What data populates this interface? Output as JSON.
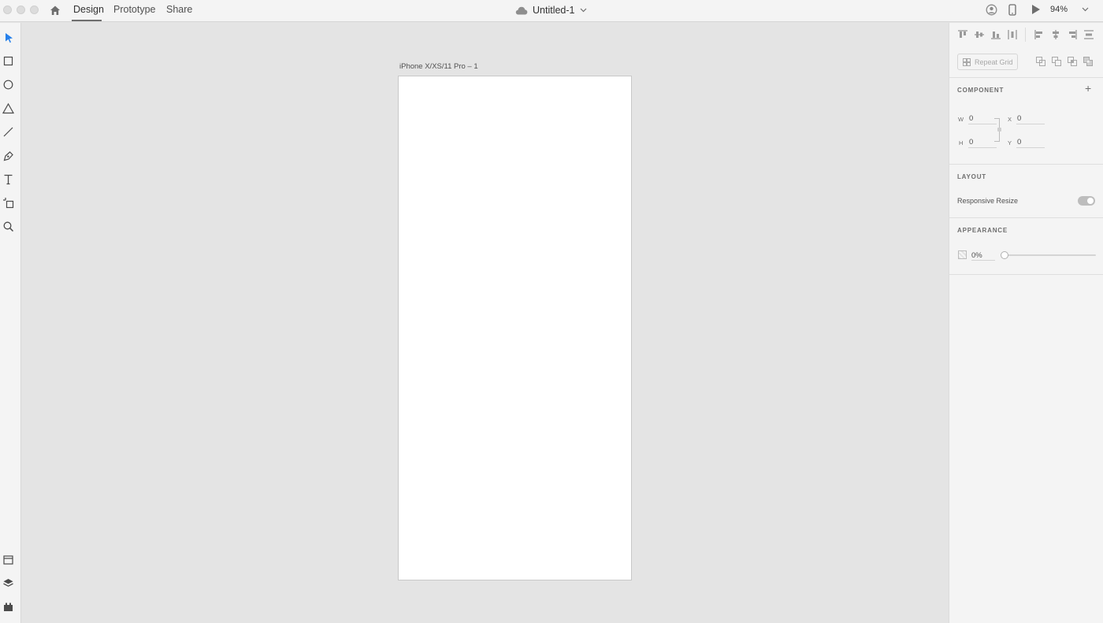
{
  "window": {
    "title": "Untitled-1"
  },
  "tabs": [
    {
      "label": "Design",
      "active": true
    },
    {
      "label": "Prototype",
      "active": false
    },
    {
      "label": "Share",
      "active": false
    }
  ],
  "toolbar_right": {
    "zoom": "94%"
  },
  "left_tools": [
    "select-icon",
    "rectangle-icon",
    "ellipse-icon",
    "polygon-icon",
    "line-icon",
    "pen-icon",
    "text-icon",
    "artboard-icon",
    "zoom-icon"
  ],
  "left_bottom_tools": [
    "assets-icon",
    "layers-icon",
    "plugins-icon"
  ],
  "canvas": {
    "artboard_label": "iPhone X/XS/11 Pro – 1"
  },
  "panel": {
    "repeat_grid": "Repeat Grid",
    "component": {
      "title": "COMPONENT"
    },
    "dimensions": {
      "w_label": "W",
      "w": "0",
      "h_label": "H",
      "h": "0",
      "x_label": "X",
      "x": "0",
      "y_label": "Y",
      "y": "0"
    },
    "layout": {
      "title": "LAYOUT",
      "responsive_resize": "Responsive Resize",
      "responsive_resize_on": true
    },
    "appearance": {
      "title": "APPEARANCE",
      "opacity": "0%",
      "opacity_value": 0
    }
  },
  "colors": {
    "accent": "#2680eb",
    "canvas_bg": "#e4e4e4",
    "panel_bg": "#f4f4f4"
  }
}
